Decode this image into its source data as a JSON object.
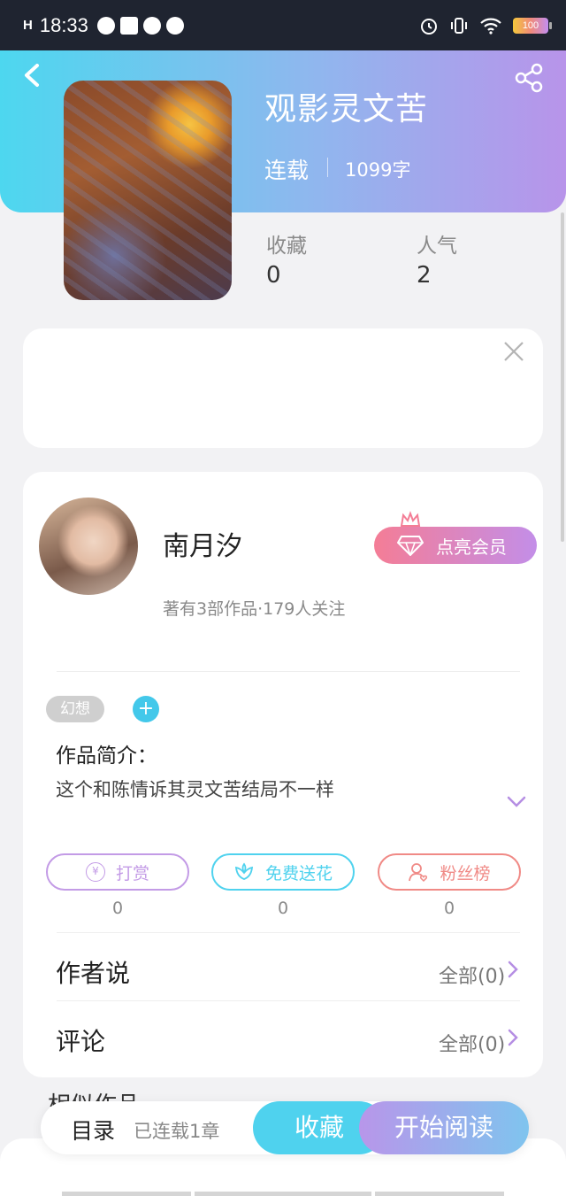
{
  "status_bar": {
    "signal": "H",
    "time": "18:33",
    "battery": "100"
  },
  "book": {
    "title": "观影灵文苦",
    "status": "连载",
    "word_count": "1099字",
    "stats": [
      {
        "label": "收藏",
        "value": "0"
      },
      {
        "label": "人气",
        "value": "2"
      }
    ]
  },
  "author": {
    "name": "南月汐",
    "meta": "著有3部作品·179人关注",
    "vip_label": "点亮会员"
  },
  "tags": [
    "幻想"
  ],
  "intro": {
    "title": "作品简介：",
    "text": "这个和陈情诉其灵文苦结局不一样"
  },
  "actions": [
    {
      "label": "打赏",
      "count": "0",
      "color": "#c39be6"
    },
    {
      "label": "免费送花",
      "count": "0",
      "color": "#4fd2ee"
    },
    {
      "label": "粉丝榜",
      "count": "0",
      "color": "#f08a86"
    }
  ],
  "sections": {
    "author_says": {
      "title": "作者说",
      "link": "全部(0)"
    },
    "comments": {
      "title": "评论",
      "link": "全部(0)"
    },
    "similar_title": "相似作品"
  },
  "bottom_bar": {
    "toc": "目录",
    "chapters": "已连载1章",
    "favorite": "收藏",
    "start_reading": "开始阅读"
  },
  "colors": {
    "accent_cyan": "#4fd2ee",
    "accent_purple": "#b896ea",
    "accent_pink": "#f47d96"
  }
}
